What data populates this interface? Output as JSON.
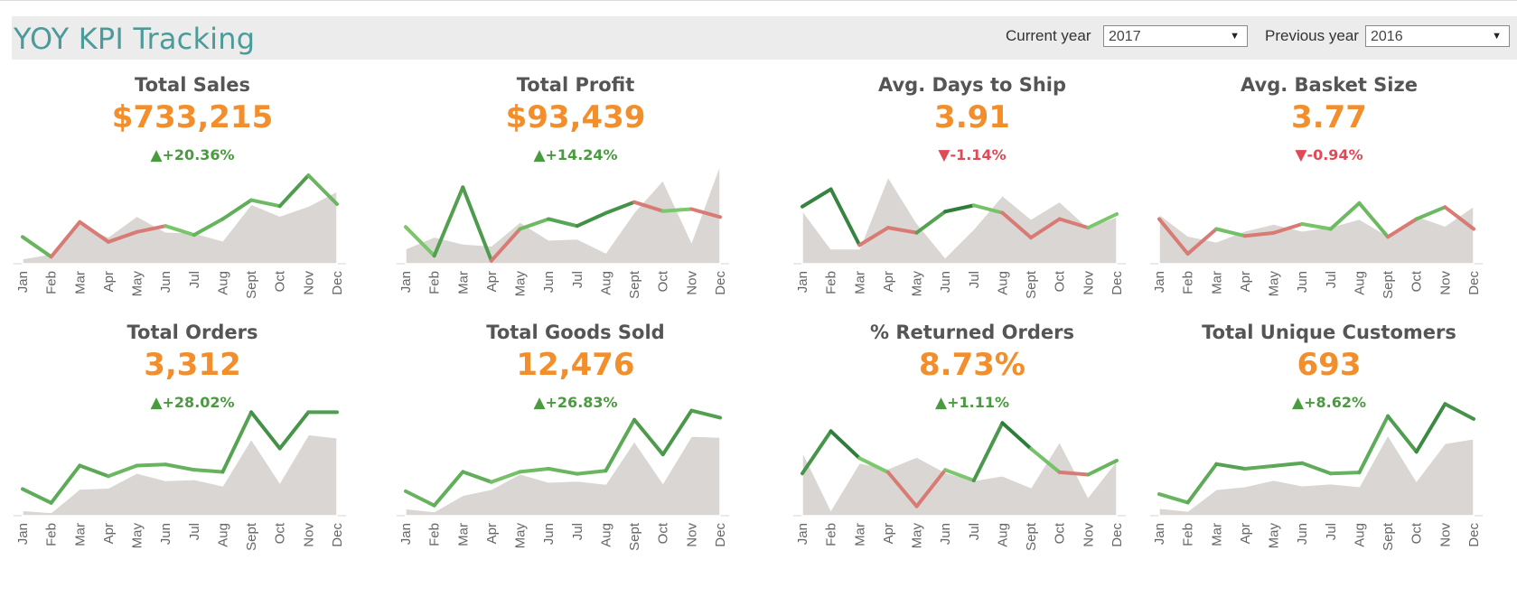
{
  "header": {
    "title": "YOY KPI Tracking",
    "current_year_label": "Current year",
    "current_year_value": "2017",
    "previous_year_label": "Previous year",
    "previous_year_value": "2016"
  },
  "colors": {
    "title": "#4b9b9a",
    "value": "#f28e2b",
    "up": "#4a9a3f",
    "down": "#e04a56",
    "area": "#d9d6d3",
    "line_up_strong": "#2f7d3a",
    "line_up_light": "#7dc96d",
    "line_down": "#d87b74"
  },
  "icons": {
    "up": "triangle-up-icon",
    "down": "triangle-down-icon",
    "dropdown": "chevron-down-icon"
  },
  "chart_data": [
    {
      "type": "area",
      "title": "Total Sales",
      "value": "$733,215",
      "delta": "+20.36%",
      "direction": "up",
      "categories": [
        "Jan",
        "Feb",
        "Mar",
        "Apr",
        "May",
        "Jun",
        "Jul",
        "Aug",
        "Sept",
        "Oct",
        "Nov",
        "Dec"
      ],
      "series": [
        {
          "values": [
            27,
            7,
            42,
            22,
            32,
            38,
            29,
            45,
            64,
            58,
            89,
            60
          ]
        },
        {
          "values": [
            5,
            10,
            40,
            27,
            48,
            32,
            31,
            23,
            60,
            48,
            58,
            73
          ]
        }
      ],
      "ylim": [
        0,
        100
      ]
    },
    {
      "type": "area",
      "title": "Total Profit",
      "value": "$93,439",
      "delta": "+14.24%",
      "direction": "up",
      "categories": [
        "Jan",
        "Feb",
        "Mar",
        "Apr",
        "May",
        "Jun",
        "Jul",
        "Aug",
        "Sept",
        "Oct",
        "Nov",
        "Dec"
      ],
      "series": [
        {
          "values": [
            37,
            8,
            77,
            3,
            35,
            45,
            38,
            51,
            62,
            53,
            55,
            47
          ]
        },
        {
          "values": [
            15,
            27,
            20,
            18,
            42,
            24,
            25,
            11,
            52,
            84,
            22,
            100
          ]
        }
      ],
      "ylim": [
        0,
        100
      ]
    },
    {
      "type": "area",
      "title": "Avg. Days to Ship",
      "value": "3.91",
      "delta": "-1.14%",
      "direction": "down",
      "categories": [
        "Jan",
        "Feb",
        "Mar",
        "Apr",
        "May",
        "Jun",
        "Jul",
        "Aug",
        "Sept",
        "Oct",
        "Nov",
        "Dec"
      ],
      "series": [
        {
          "values": [
            46,
            60,
            15,
            29,
            25,
            42,
            47,
            41,
            21,
            36,
            29,
            40
          ]
        },
        {
          "values": [
            43,
            12,
            12,
            70,
            33,
            5,
            28,
            55,
            36,
            50,
            29,
            38
          ]
        }
      ],
      "ylim": [
        0,
        80
      ]
    },
    {
      "type": "area",
      "title": "Avg. Basket Size",
      "value": "3.77",
      "delta": "-0.94%",
      "direction": "down",
      "categories": [
        "Jan",
        "Feb",
        "Mar",
        "Apr",
        "May",
        "Jun",
        "Jul",
        "Aug",
        "Sept",
        "Oct",
        "Nov",
        "Dec"
      ],
      "series": [
        {
          "values": [
            45,
            10,
            35,
            28,
            31,
            40,
            35,
            61,
            27,
            45,
            57,
            35
          ]
        },
        {
          "values": [
            50,
            28,
            22,
            33,
            40,
            33,
            37,
            45,
            28,
            48,
            38,
            58
          ]
        }
      ],
      "ylim": [
        0,
        100
      ]
    },
    {
      "type": "area",
      "title": "Total Orders",
      "value": "3,312",
      "delta": "+28.02%",
      "direction": "up",
      "categories": [
        "Jan",
        "Feb",
        "Mar",
        "Apr",
        "May",
        "Jun",
        "Jul",
        "Aug",
        "Sept",
        "Oct",
        "Nov",
        "Dec"
      ],
      "series": [
        {
          "values": [
            25,
            12,
            47,
            37,
            47,
            48,
            43,
            41,
            97,
            63,
            97,
            97
          ]
        },
        {
          "values": [
            5,
            3,
            25,
            26,
            40,
            33,
            34,
            28,
            72,
            31,
            76,
            73
          ]
        }
      ],
      "ylim": [
        0,
        110
      ]
    },
    {
      "type": "area",
      "title": "Total Goods Sold",
      "value": "12,476",
      "delta": "+26.83%",
      "direction": "up",
      "categories": [
        "Jan",
        "Feb",
        "Mar",
        "Apr",
        "May",
        "Jun",
        "Jul",
        "Aug",
        "Sept",
        "Oct",
        "Nov",
        "Dec"
      ],
      "series": [
        {
          "values": [
            24,
            10,
            43,
            33,
            43,
            46,
            41,
            44,
            94,
            60,
            103,
            96
          ]
        },
        {
          "values": [
            7,
            4,
            20,
            26,
            41,
            33,
            34,
            31,
            73,
            32,
            78,
            77
          ]
        }
      ],
      "ylim": [
        0,
        115
      ]
    },
    {
      "type": "area",
      "title": "% Returned Orders",
      "value": "8.73%",
      "delta": "+1.11%",
      "direction": "up",
      "categories": [
        "Jan",
        "Feb",
        "Mar",
        "Apr",
        "May",
        "Jun",
        "Jul",
        "Aug",
        "Sept",
        "Oct",
        "Nov",
        "Dec"
      ],
      "series": [
        {
          "values": [
            36,
            72,
            49,
            37,
            8,
            39,
            30,
            79,
            57,
            37,
            35,
            47
          ]
        },
        {
          "values": [
            55,
            5,
            45,
            40,
            50,
            37,
            30,
            34,
            24,
            63,
            16,
            47
          ]
        }
      ],
      "ylim": [
        0,
        100
      ]
    },
    {
      "type": "area",
      "title": "Total Unique Customers",
      "value": "693",
      "delta": "+8.62%",
      "direction": "up",
      "categories": [
        "Jan",
        "Feb",
        "Mar",
        "Apr",
        "May",
        "Jun",
        "Jul",
        "Aug",
        "Sept",
        "Oct",
        "Nov",
        "Dec"
      ],
      "series": [
        {
          "values": [
            23,
            14,
            55,
            50,
            53,
            56,
            45,
            46,
            106,
            68,
            119,
            103
          ]
        },
        {
          "values": [
            8,
            5,
            28,
            31,
            38,
            32,
            34,
            31,
            86,
            37,
            77,
            82
          ]
        }
      ],
      "ylim": [
        0,
        125
      ]
    }
  ]
}
